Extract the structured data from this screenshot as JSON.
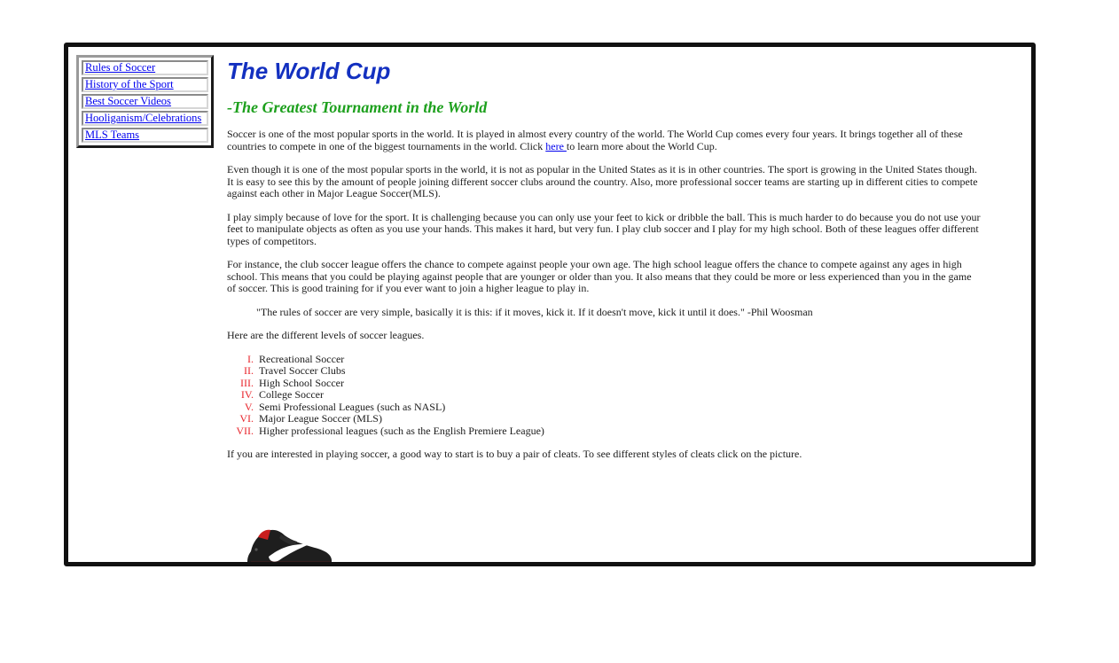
{
  "nav": {
    "items": [
      {
        "label": "Rules of Soccer"
      },
      {
        "label": "History of the Sport"
      },
      {
        "label": "Best Soccer Videos"
      },
      {
        "label": "Hooliganism/Celebrations"
      },
      {
        "label": "MLS Teams"
      }
    ]
  },
  "main": {
    "title": "The World Cup",
    "subtitle": "-The Greatest Tournament in the World",
    "p1": {
      "before_link": "Soccer is one of the most popular sports in the world. It is played in almost every country of the world. The World Cup comes every four years. It brings together all of these countries to compete in one of the biggest tournaments in the world. Click ",
      "link": "here ",
      "after_link": "to learn more about the World Cup."
    },
    "p2": "Even though it is one of the most popular sports in the world, it is not as popular in the United States as it is in other countries. The sport is growing in the United States though. It is easy to see this by the amount of people joining different soccer clubs around the country. Also, more professional soccer teams are starting up in different cities to compete against each other in Major League Soccer(MLS).",
    "p3": "I play simply because of love for the sport. It is challenging because you can only use your feet to kick or dribble the ball. This is much harder to do because you do not use your feet to manipulate objects as often as you use your hands. This makes it hard, but very fun. I play club soccer and I play for my high school. Both of these leagues offer different types of competitors.",
    "p4": "For instance, the club soccer league offers the chance to compete against people your own age. The high school league offers the chance to compete against any ages in high school. This means that you could be playing against people that are younger or older than you. It also means that they could be more or less experienced than you in the game of soccer. This is good training for if you ever want to join a higher league to play in.",
    "quote": "\"The rules of soccer are very simple, basically it is this: if it moves, kick it. If it doesn't move, kick it until it does.\" -Phil Woosman",
    "levels_intro": "Here are the different levels of soccer leagues.",
    "levels": [
      "Recreational Soccer",
      "Travel Soccer Clubs",
      "High School Soccer",
      "College Soccer",
      "Semi Professional Leagues (such as NASL)",
      "Major League Soccer (MLS)",
      "Higher professional leagues (such as the English Premiere League)"
    ],
    "cleats_text": "If you are interested in playing soccer, a good way to start is to buy a pair of cleats. To see different styles of cleats click on the picture."
  },
  "colors": {
    "title": "#1330c0",
    "subtitle": "#1da01d",
    "link": "#0000ee",
    "list_marker": "#e8242b",
    "frame_border": "#111111"
  },
  "icons": {
    "cleat": "soccer-cleat-image"
  }
}
